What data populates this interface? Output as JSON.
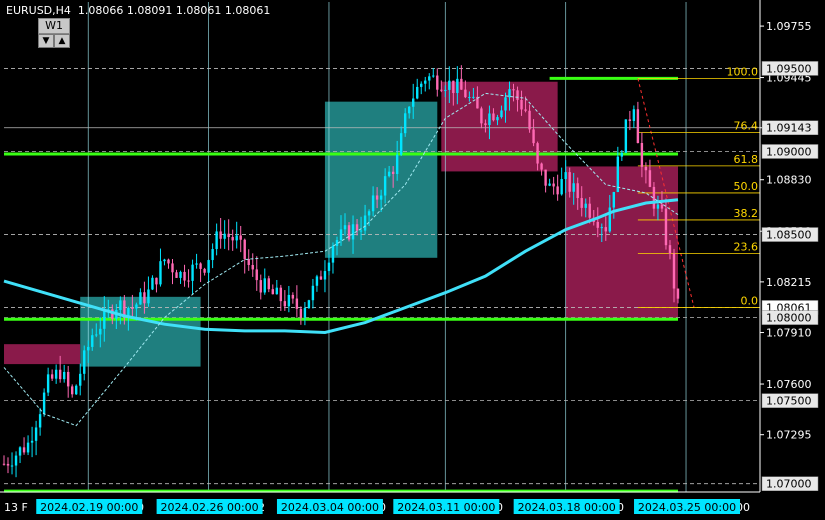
{
  "header": {
    "symbol": "EURUSD,H4",
    "ohlc": "1.08066 1.08091 1.08061 1.08061",
    "timeframe_badge": "W1",
    "btn_down": "▼",
    "btn_up": "▲"
  },
  "colors": {
    "background": "#000000",
    "bull": "#00e5ff",
    "bear": "#ff69b4",
    "ma": "#40e0f8",
    "demand_zone": "#1f7f7f",
    "supply_zone": "#8a1a4a",
    "green_line": "#39ff14",
    "fib": "#ffd700",
    "axis_text": "#ffffff",
    "price_label_bg": "#ffffff",
    "date_label_bg": "#00e5ff"
  },
  "chart_data": {
    "type": "candlestick",
    "symbol": "EURUSD",
    "timeframe": "H4",
    "ylim": [
      1.0695,
      1.099
    ],
    "xlim_bars": [
      0,
      152
    ],
    "price_ticks": [
      "1.09755",
      "1.09445",
      "1.09143",
      "1.08830",
      "1.08520",
      "1.08215",
      "1.07910",
      "1.07600",
      "1.07295"
    ],
    "level_labels": [
      "1.09500",
      "1.09143",
      "1.09000",
      "1.08500",
      "1.08061",
      "1.08000",
      "1.07500",
      "1.07000"
    ],
    "level_values": [
      1.095,
      1.09143,
      1.09,
      1.085,
      1.08061,
      1.08,
      1.075,
      1.07
    ],
    "current_price": "1.08061",
    "date_labels": [
      {
        "label": "2024.02.19 00:00",
        "bar": 21
      },
      {
        "label": "2024.02.26 00:00",
        "bar": 51
      },
      {
        "label": "2024.03.04 00:00",
        "bar": 81
      },
      {
        "label": "2024.03.11 00:00",
        "bar": 110
      },
      {
        "label": "2024.03.18 00:00",
        "bar": 140
      },
      {
        "label": "2024.03.25 00:00",
        "bar": 170
      }
    ],
    "axis_fragments": [
      "13 F",
      "0",
      "2",
      "00",
      "0",
      "0",
      "00"
    ],
    "day_separators_bars": [
      21,
      51,
      81,
      110,
      140,
      170
    ],
    "green_lines": [
      1.0944,
      1.08985,
      1.0799,
      1.06955
    ],
    "zones": [
      {
        "kind": "demand",
        "bar_from": 19,
        "bar_to": 49,
        "top": 1.08125,
        "bottom": 1.07705
      },
      {
        "kind": "demand",
        "bar_from": 80,
        "bar_to": 108,
        "top": 1.093,
        "bottom": 1.0836
      },
      {
        "kind": "supply",
        "bar_from": 109,
        "bar_to": 138,
        "top": 1.0942,
        "bottom": 1.0888
      },
      {
        "kind": "supply",
        "bar_from": 140,
        "bar_to": 168,
        "top": 1.0891,
        "bottom": 1.0799
      },
      {
        "kind": "supply",
        "bar_from": 0,
        "bar_to": 19,
        "top": 1.0784,
        "bottom": 1.0772
      }
    ],
    "fibonacci": {
      "high": 1.0944,
      "low": 1.08061,
      "levels": [
        {
          "label": "100.0",
          "ratio": 1.0
        },
        {
          "label": "76.4",
          "ratio": 0.764
        },
        {
          "label": "61.8",
          "ratio": 0.618
        },
        {
          "label": "50.0",
          "ratio": 0.5
        },
        {
          "label": "38.2",
          "ratio": 0.382
        },
        {
          "label": "23.6",
          "ratio": 0.236
        },
        {
          "label": "0.0",
          "ratio": 0.0
        }
      ]
    },
    "ma_slow": [
      [
        0,
        1.0822
      ],
      [
        10,
        1.0815
      ],
      [
        20,
        1.0808
      ],
      [
        30,
        1.0801
      ],
      [
        40,
        1.0796
      ],
      [
        50,
        1.0793
      ],
      [
        60,
        1.0792
      ],
      [
        70,
        1.0792
      ],
      [
        80,
        1.0791
      ],
      [
        90,
        1.0797
      ],
      [
        100,
        1.0806
      ],
      [
        110,
        1.0815
      ],
      [
        120,
        1.0825
      ],
      [
        130,
        1.084
      ],
      [
        140,
        1.0853
      ],
      [
        148,
        1.086
      ],
      [
        152,
        1.0864
      ],
      [
        160,
        1.0869
      ],
      [
        168,
        1.0871
      ]
    ],
    "ma_fast": [
      [
        0,
        1.077
      ],
      [
        10,
        1.0742
      ],
      [
        18,
        1.0735
      ],
      [
        30,
        1.077
      ],
      [
        40,
        1.08
      ],
      [
        50,
        1.082
      ],
      [
        60,
        1.0835
      ],
      [
        70,
        1.0837
      ],
      [
        80,
        1.084
      ],
      [
        90,
        1.0855
      ],
      [
        100,
        1.088
      ],
      [
        110,
        1.092
      ],
      [
        120,
        1.0935
      ],
      [
        130,
        1.0932
      ],
      [
        140,
        1.0905
      ],
      [
        150,
        1.088
      ],
      [
        160,
        1.0875
      ],
      [
        168,
        1.0862
      ]
    ],
    "candles_anchor": [
      [
        0,
        1.0712
      ],
      [
        6,
        1.0724
      ],
      [
        11,
        1.076
      ],
      [
        14,
        1.0768
      ],
      [
        17,
        1.0752
      ],
      [
        22,
        1.079
      ],
      [
        28,
        1.0808
      ],
      [
        32,
        1.0806
      ],
      [
        36,
        1.0815
      ],
      [
        40,
        1.0835
      ],
      [
        44,
        1.0826
      ],
      [
        50,
        1.0832
      ],
      [
        54,
        1.0852
      ],
      [
        58,
        1.0846
      ],
      [
        62,
        1.0826
      ],
      [
        66,
        1.0815
      ],
      [
        70,
        1.081
      ],
      [
        74,
        1.0805
      ],
      [
        78,
        1.082
      ],
      [
        82,
        1.0845
      ],
      [
        86,
        1.0852
      ],
      [
        90,
        1.0858
      ],
      [
        94,
        1.0878
      ],
      [
        98,
        1.0895
      ],
      [
        101,
        1.093
      ],
      [
        105,
        1.0945
      ],
      [
        110,
        1.0942
      ],
      [
        115,
        1.0935
      ],
      [
        119,
        1.092
      ],
      [
        123,
        1.0925
      ],
      [
        126,
        1.0938
      ],
      [
        130,
        1.0925
      ],
      [
        133,
        1.089
      ],
      [
        136,
        1.0878
      ],
      [
        140,
        1.0882
      ],
      [
        144,
        1.087
      ],
      [
        148,
        1.086
      ],
      [
        150,
        1.0855
      ],
      [
        154,
        1.0905
      ],
      [
        157,
        1.093
      ],
      [
        159,
        1.089
      ],
      [
        162,
        1.087
      ],
      [
        164,
        1.086
      ],
      [
        166,
        1.0835
      ],
      [
        168,
        1.0806
      ]
    ]
  }
}
